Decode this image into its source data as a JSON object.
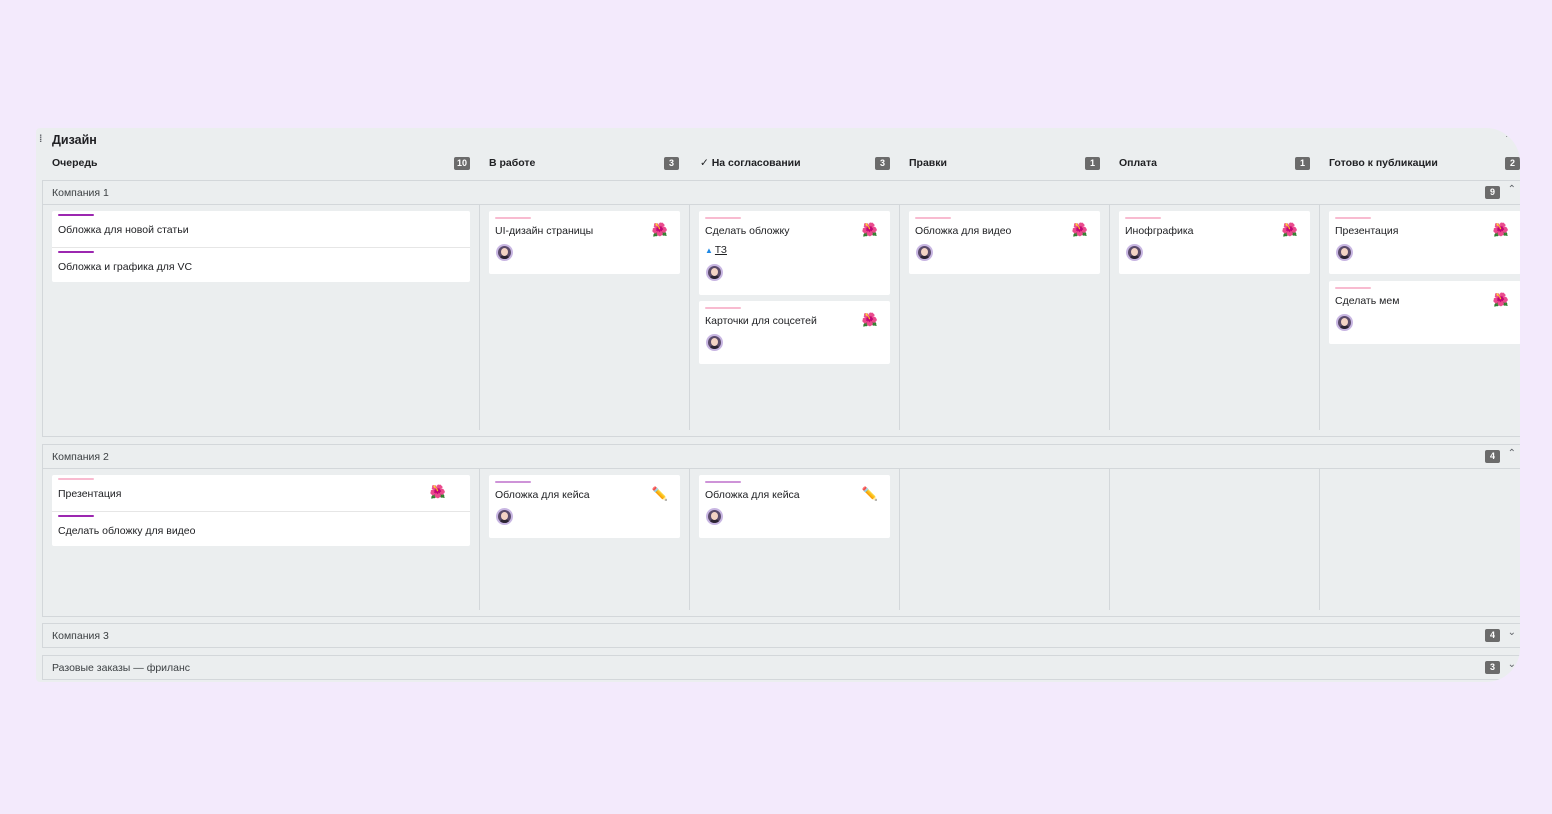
{
  "board": {
    "title": "Дизайн",
    "drag_icon": "drag-handle-icon"
  },
  "columns": [
    {
      "label": "Очередь",
      "count": "10"
    },
    {
      "label": "В работе",
      "count": "3"
    },
    {
      "label": "✓ На согласовании",
      "count": "3"
    },
    {
      "label": "Правки",
      "count": "1"
    },
    {
      "label": "Оплата",
      "count": "1"
    },
    {
      "label": "Готово к публикации",
      "count": "2"
    }
  ],
  "swimlanes": [
    {
      "name": "Компания 1",
      "count": "9",
      "chevron": "^"
    },
    {
      "name": "Компания 2",
      "count": "4",
      "chevron": "^"
    },
    {
      "name": "Компания 3",
      "count": "4",
      "chevron": "v"
    },
    {
      "name": "Разовые заказы — фриланс",
      "count": "3",
      "chevron": "v"
    }
  ],
  "lane1": {
    "queue": [
      {
        "title": "Обложка для новой статьи",
        "color": "#9c27b0"
      },
      {
        "title": "Обложка и графика для VC",
        "color": "#9c27b0"
      }
    ],
    "in_work": [
      {
        "title": "UI-дизайн страницы",
        "emoji": "🌺",
        "color": "#f8bbd0"
      }
    ],
    "approval": [
      {
        "title": "Сделать обложку",
        "emoji": "🌺",
        "color": "#f8bbd0",
        "link": "ТЗ"
      },
      {
        "title": "Карточки для соцсетей",
        "emoji": "🌺",
        "color": "#f8bbd0"
      }
    ],
    "edits": [
      {
        "title": "Обложка для видео",
        "emoji": "🌺",
        "color": "#f8bbd0"
      }
    ],
    "payment": [
      {
        "title": "Инофграфика",
        "emoji": "🌺",
        "color": "#f8bbd0"
      }
    ],
    "ready": [
      {
        "title": "Презентация",
        "emoji": "🌺",
        "color": "#f8bbd0"
      },
      {
        "title": "Сделать мем",
        "emoji": "🌺",
        "color": "#f8bbd0"
      }
    ]
  },
  "lane2": {
    "queue": [
      {
        "title": "Презентация",
        "emoji": "🌺",
        "color": "#f8bbd0"
      },
      {
        "title": "Сделать обложку для видео",
        "color": "#9c27b0"
      }
    ],
    "in_work": [
      {
        "title": "Обложка для кейса",
        "emoji": "✏️",
        "color": "#ce93d8"
      }
    ],
    "approval": [
      {
        "title": "Обложка для кейса",
        "emoji": "✏️",
        "color": "#ce93d8"
      }
    ]
  }
}
